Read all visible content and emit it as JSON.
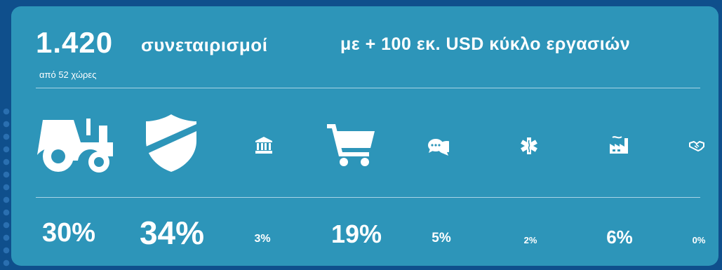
{
  "headline": {
    "count": "1.420",
    "count_label": "συνεταιρισμοί",
    "turnover": "με + 100 εκ. USD  κύκλο εργασιών",
    "subtitle": "από 52 χώρες"
  },
  "sectors": [
    {
      "icon": "tractor-icon",
      "percent": "30%"
    },
    {
      "icon": "shield-icon",
      "percent": "34%"
    },
    {
      "icon": "bank-icon",
      "percent": "3%"
    },
    {
      "icon": "shopping-cart-icon",
      "percent": "19%"
    },
    {
      "icon": "chat-bubbles-icon",
      "percent": "5%"
    },
    {
      "icon": "medical-star-icon",
      "percent": "2%"
    },
    {
      "icon": "factory-icon",
      "percent": "6%"
    },
    {
      "icon": "handshake-icon",
      "percent": "0%"
    }
  ],
  "colors": {
    "background": "#0f4f8c",
    "card": "#2d95b9",
    "text": "#ffffff"
  }
}
